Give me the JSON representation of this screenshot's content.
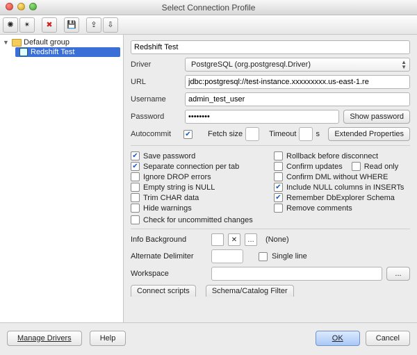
{
  "window": {
    "title": "Select Connection Profile"
  },
  "toolbar": {
    "icons": [
      "new-profile-icon",
      "new-profile-alt-icon",
      "delete-icon",
      "save-icon",
      "import-icon",
      "export-icon"
    ]
  },
  "tree": {
    "group_label": "Default group",
    "profiles": [
      {
        "label": "Redshift Test",
        "selected": true
      }
    ]
  },
  "profile": {
    "name": "Redshift Test",
    "driver_label": "Driver",
    "driver_value": "PostgreSQL (org.postgresql.Driver)",
    "url_label": "URL",
    "url_value": "jdbc:postgresql://test-instance.xxxxxxxxx.us-east-1.re",
    "username_label": "Username",
    "username_value": "admin_test_user",
    "password_label": "Password",
    "password_value": "••••••••",
    "show_password": "Show password",
    "autocommit_label": "Autocommit",
    "autocommit_checked": true,
    "fetch_label": "Fetch size",
    "fetch_value": "",
    "timeout_label": "Timeout",
    "timeout_value": "",
    "timeout_unit": "s",
    "extended_props": "Extended Properties"
  },
  "options_left": [
    {
      "label": "Save password",
      "checked": true
    },
    {
      "label": "Separate connection per tab",
      "checked": true
    },
    {
      "label": "Ignore DROP errors",
      "checked": false
    },
    {
      "label": "Empty string is NULL",
      "checked": false
    },
    {
      "label": "Trim CHAR data",
      "checked": false,
      "small": true
    },
    {
      "label": "Hide warnings",
      "checked": false
    }
  ],
  "options_right": [
    {
      "label": "Rollback before disconnect",
      "checked": false
    },
    {
      "label": "Confirm updates",
      "checked": false,
      "inline": "Read only",
      "inline_checked": false
    },
    {
      "label": "Confirm DML without WHERE",
      "checked": false,
      "small_tail": true
    },
    {
      "label": "Include NULL columns in INSERTs",
      "checked": true
    },
    {
      "label": "Remember DbExplorer Schema",
      "checked": true
    },
    {
      "label": "Remove comments",
      "checked": false
    }
  ],
  "option_bottom": {
    "label": "Check for uncommitted changes",
    "checked": false
  },
  "info_bg": {
    "label": "Info Background",
    "none": "(None)"
  },
  "alt_delim": {
    "label": "Alternate Delimiter",
    "value": "",
    "single_line": "Single line",
    "single_checked": false
  },
  "workspace": {
    "label": "Workspace",
    "value": "",
    "browse": "..."
  },
  "tabs": {
    "connect_scripts": "Connect scripts",
    "schema_filter": "Schema/Catalog Filter"
  },
  "footer": {
    "manage_drivers": "Manage Drivers",
    "help": "Help",
    "ok": "OK",
    "cancel": "Cancel"
  }
}
